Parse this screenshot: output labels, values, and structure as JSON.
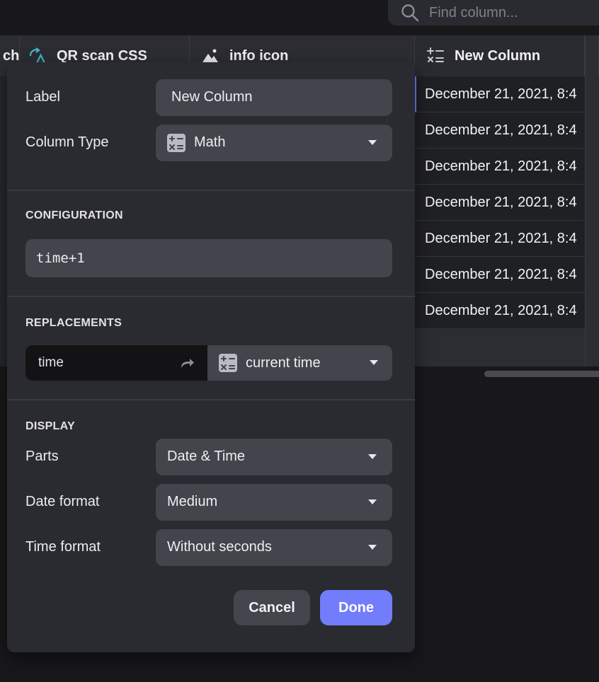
{
  "search": {
    "placeholder": "Find column..."
  },
  "grid": {
    "headers": [
      {
        "label": "ch",
        "icon": "partial-icon"
      },
      {
        "label": "QR scan CSS",
        "icon": "qr-transform-icon"
      },
      {
        "label": "info icon",
        "icon": "image-icon"
      },
      {
        "label": "New Column",
        "icon": "math-icon"
      }
    ],
    "rows": [
      "December 21, 2021, 8:4",
      "December 21, 2021, 8:4",
      "December 21, 2021, 8:4",
      "December 21, 2021, 8:4",
      "December 21, 2021, 8:4",
      "December 21, 2021, 8:4",
      "December 21, 2021, 8:4"
    ]
  },
  "panel": {
    "label_label": "Label",
    "label_value": "New Column",
    "type_label": "Column Type",
    "type_value": "Math",
    "configuration_title": "CONFIGURATION",
    "formula": "time+1",
    "replacements_title": "REPLACEMENTS",
    "replacement": {
      "source": "time",
      "target": "current time"
    },
    "display_title": "DISPLAY",
    "parts_label": "Parts",
    "parts_value": "Date & Time",
    "date_format_label": "Date format",
    "date_format_value": "Medium",
    "time_format_label": "Time format",
    "time_format_value": "Without seconds",
    "cancel_label": "Cancel",
    "done_label": "Done"
  },
  "colors": {
    "accent": "#717dfb",
    "panel": "#2a2b30",
    "control": "#43444c"
  }
}
